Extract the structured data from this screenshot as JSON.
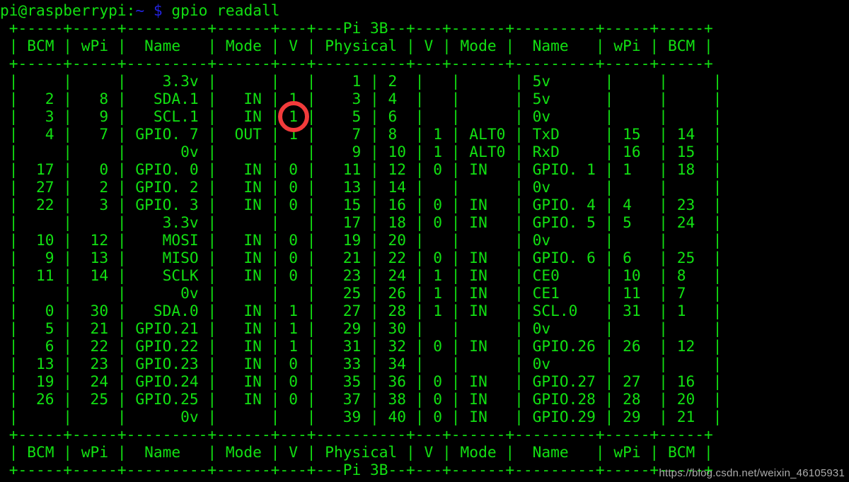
{
  "terminal": {
    "prompt": {
      "user_host": "pi@raspberrypi:",
      "path": "~",
      "sigil": "$",
      "command": "gpio readall"
    },
    "colors": {
      "background": "#000000",
      "foreground": "#12e012",
      "prompt_blue": "#2222dd",
      "annotation_red": "#f23b3b",
      "watermark_gray": "#c9c9c9"
    },
    "board_label": "Pi 3B",
    "columns_left": [
      "BCM",
      "wPi",
      "Name",
      "Mode",
      "V",
      "Physical"
    ],
    "columns_right": [
      "V",
      "Mode",
      "Name",
      "wPi",
      "BCM"
    ],
    "rows": [
      {
        "bcm_l": "",
        "wpi_l": "",
        "name_l": "3.3v",
        "mode_l": "",
        "v_l": "",
        "phys_l": "1",
        "phys_r": "2",
        "v_r": "",
        "mode_r": "",
        "name_r": "5v",
        "wpi_r": "",
        "bcm_r": ""
      },
      {
        "bcm_l": "2",
        "wpi_l": "8",
        "name_l": "SDA.1",
        "mode_l": "IN",
        "v_l": "1",
        "phys_l": "3",
        "phys_r": "4",
        "v_r": "",
        "mode_r": "",
        "name_r": "5v",
        "wpi_r": "",
        "bcm_r": ""
      },
      {
        "bcm_l": "3",
        "wpi_l": "9",
        "name_l": "SCL.1",
        "mode_l": "IN",
        "v_l": "1",
        "phys_l": "5",
        "phys_r": "6",
        "v_r": "",
        "mode_r": "",
        "name_r": "0v",
        "wpi_r": "",
        "bcm_r": ""
      },
      {
        "bcm_l": "4",
        "wpi_l": "7",
        "name_l": "GPIO. 7",
        "mode_l": "OUT",
        "v_l": "1",
        "phys_l": "7",
        "phys_r": "8",
        "v_r": "1",
        "mode_r": "ALT0",
        "name_r": "TxD",
        "wpi_r": "15",
        "bcm_r": "14"
      },
      {
        "bcm_l": "",
        "wpi_l": "",
        "name_l": "0v",
        "mode_l": "",
        "v_l": "",
        "phys_l": "9",
        "phys_r": "10",
        "v_r": "1",
        "mode_r": "ALT0",
        "name_r": "RxD",
        "wpi_r": "16",
        "bcm_r": "15"
      },
      {
        "bcm_l": "17",
        "wpi_l": "0",
        "name_l": "GPIO. 0",
        "mode_l": "IN",
        "v_l": "0",
        "phys_l": "11",
        "phys_r": "12",
        "v_r": "0",
        "mode_r": "IN",
        "name_r": "GPIO. 1",
        "wpi_r": "1",
        "bcm_r": "18"
      },
      {
        "bcm_l": "27",
        "wpi_l": "2",
        "name_l": "GPIO. 2",
        "mode_l": "IN",
        "v_l": "0",
        "phys_l": "13",
        "phys_r": "14",
        "v_r": "",
        "mode_r": "",
        "name_r": "0v",
        "wpi_r": "",
        "bcm_r": ""
      },
      {
        "bcm_l": "22",
        "wpi_l": "3",
        "name_l": "GPIO. 3",
        "mode_l": "IN",
        "v_l": "0",
        "phys_l": "15",
        "phys_r": "16",
        "v_r": "0",
        "mode_r": "IN",
        "name_r": "GPIO. 4",
        "wpi_r": "4",
        "bcm_r": "23"
      },
      {
        "bcm_l": "",
        "wpi_l": "",
        "name_l": "3.3v",
        "mode_l": "",
        "v_l": "",
        "phys_l": "17",
        "phys_r": "18",
        "v_r": "0",
        "mode_r": "IN",
        "name_r": "GPIO. 5",
        "wpi_r": "5",
        "bcm_r": "24"
      },
      {
        "bcm_l": "10",
        "wpi_l": "12",
        "name_l": "MOSI",
        "mode_l": "IN",
        "v_l": "0",
        "phys_l": "19",
        "phys_r": "20",
        "v_r": "",
        "mode_r": "",
        "name_r": "0v",
        "wpi_r": "",
        "bcm_r": ""
      },
      {
        "bcm_l": "9",
        "wpi_l": "13",
        "name_l": "MISO",
        "mode_l": "IN",
        "v_l": "0",
        "phys_l": "21",
        "phys_r": "22",
        "v_r": "0",
        "mode_r": "IN",
        "name_r": "GPIO. 6",
        "wpi_r": "6",
        "bcm_r": "25"
      },
      {
        "bcm_l": "11",
        "wpi_l": "14",
        "name_l": "SCLK",
        "mode_l": "IN",
        "v_l": "0",
        "phys_l": "23",
        "phys_r": "24",
        "v_r": "1",
        "mode_r": "IN",
        "name_r": "CE0",
        "wpi_r": "10",
        "bcm_r": "8"
      },
      {
        "bcm_l": "",
        "wpi_l": "",
        "name_l": "0v",
        "mode_l": "",
        "v_l": "",
        "phys_l": "25",
        "phys_r": "26",
        "v_r": "1",
        "mode_r": "IN",
        "name_r": "CE1",
        "wpi_r": "11",
        "bcm_r": "7"
      },
      {
        "bcm_l": "0",
        "wpi_l": "30",
        "name_l": "SDA.0",
        "mode_l": "IN",
        "v_l": "1",
        "phys_l": "27",
        "phys_r": "28",
        "v_r": "1",
        "mode_r": "IN",
        "name_r": "SCL.0",
        "wpi_r": "31",
        "bcm_r": "1"
      },
      {
        "bcm_l": "5",
        "wpi_l": "21",
        "name_l": "GPIO.21",
        "mode_l": "IN",
        "v_l": "1",
        "phys_l": "29",
        "phys_r": "30",
        "v_r": "",
        "mode_r": "",
        "name_r": "0v",
        "wpi_r": "",
        "bcm_r": ""
      },
      {
        "bcm_l": "6",
        "wpi_l": "22",
        "name_l": "GPIO.22",
        "mode_l": "IN",
        "v_l": "1",
        "phys_l": "31",
        "phys_r": "32",
        "v_r": "0",
        "mode_r": "IN",
        "name_r": "GPIO.26",
        "wpi_r": "26",
        "bcm_r": "12"
      },
      {
        "bcm_l": "13",
        "wpi_l": "23",
        "name_l": "GPIO.23",
        "mode_l": "IN",
        "v_l": "0",
        "phys_l": "33",
        "phys_r": "34",
        "v_r": "",
        "mode_r": "",
        "name_r": "0v",
        "wpi_r": "",
        "bcm_r": ""
      },
      {
        "bcm_l": "19",
        "wpi_l": "24",
        "name_l": "GPIO.24",
        "mode_l": "IN",
        "v_l": "0",
        "phys_l": "35",
        "phys_r": "36",
        "v_r": "0",
        "mode_r": "IN",
        "name_r": "GPIO.27",
        "wpi_r": "27",
        "bcm_r": "16"
      },
      {
        "bcm_l": "26",
        "wpi_l": "25",
        "name_l": "GPIO.25",
        "mode_l": "IN",
        "v_l": "0",
        "phys_l": "37",
        "phys_r": "38",
        "v_r": "0",
        "mode_r": "IN",
        "name_r": "GPIO.28",
        "wpi_r": "28",
        "bcm_r": "20"
      },
      {
        "bcm_l": "",
        "wpi_l": "",
        "name_l": "0v",
        "mode_l": "",
        "v_l": "",
        "phys_l": "39",
        "phys_r": "40",
        "v_r": "0",
        "mode_r": "IN",
        "name_r": "GPIO.29",
        "wpi_r": "29",
        "bcm_r": "21"
      }
    ]
  },
  "annotation": {
    "type": "circle-highlight",
    "target_value": "1",
    "target_row_phys": "7",
    "target_column": "V",
    "color": "#f23b3b"
  },
  "watermark": {
    "text": "https://blog.csdn.net/weixin_46105931"
  }
}
